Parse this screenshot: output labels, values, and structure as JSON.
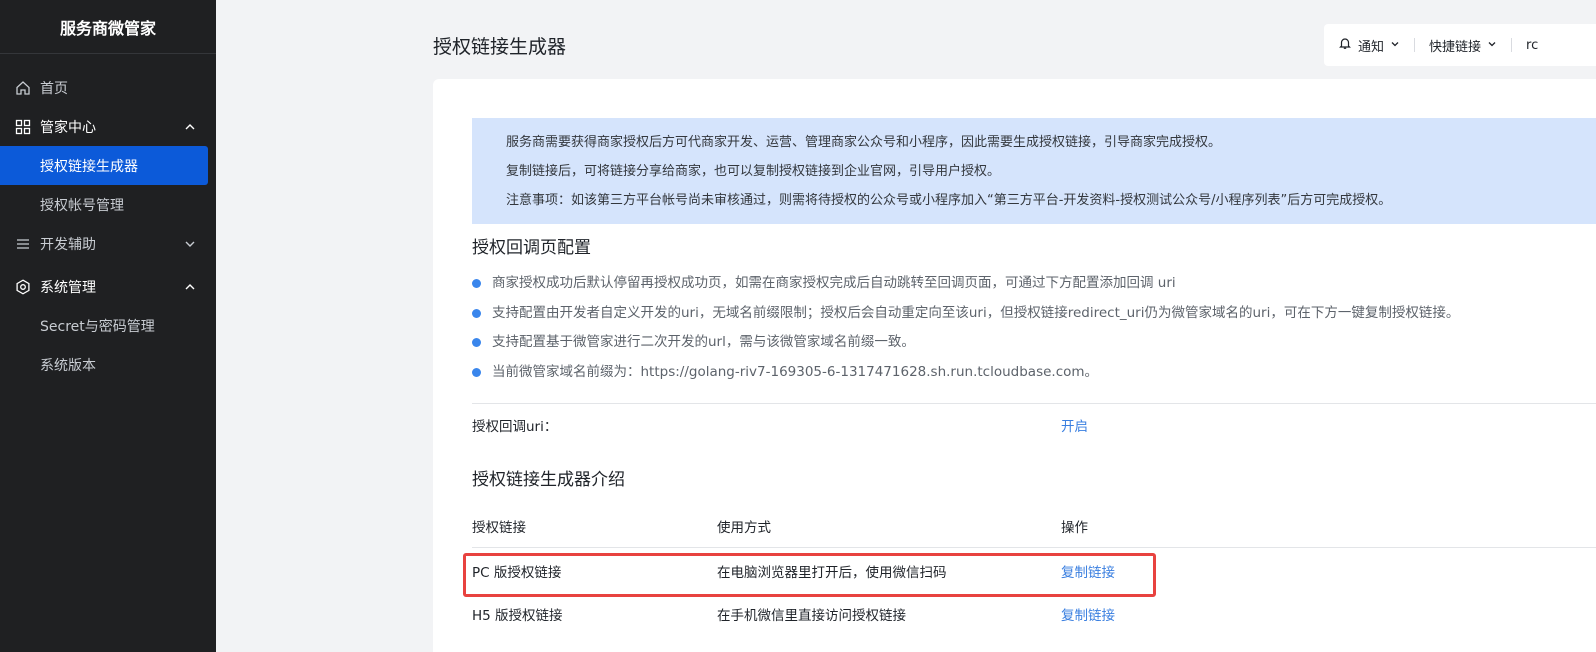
{
  "brand": "服务商微管家",
  "sidebar": {
    "home": "首页",
    "group_butler": "管家中心",
    "auth_link_generator": "授权链接生成器",
    "auth_account_mgmt": "授权帐号管理",
    "group_dev": "开发辅助",
    "group_system": "系统管理",
    "secret_mgmt": "Secret与密码管理",
    "system_version": "系统版本"
  },
  "header": {
    "title": "授权链接生成器",
    "notify": "通知",
    "quick_links": "快捷链接",
    "user_initial": "rc"
  },
  "notice": [
    "服务商需要获得商家授权后方可代商家开发、运营、管理商家公众号和小程序，因此需要生成授权链接，引导商家完成授权。",
    "复制链接后，可将链接分享给商家，也可以复制授权链接到企业官网，引导用户授权。",
    "注意事项：如该第三方平台帐号尚未审核通过，则需将待授权的公众号或小程序加入“第三方平台-开发资料-授权测试公众号/小程序列表”后方可完成授权。"
  ],
  "callback": {
    "title": "授权回调页配置",
    "bullets": [
      "商家授权成功后默认停留再授权成功页，如需在商家授权完成后自动跳转至回调页面，可通过下方配置添加回调 uri",
      "支持配置由开发者自定义开发的uri，无域名前缀限制；授权后会自动重定向至该uri，但授权链接redirect_uri仍为微管家域名的uri，可在下方一键复制授权链接。",
      "支持配置基于微管家进行二次开发的url，需与该微管家域名前缀一致。",
      "当前微管家域名前缀为：https://golang-riv7-169305-6-1317471628.sh.run.tcloudbase.com。"
    ],
    "uri_label": "授权回调uri：",
    "enable_link": "开启"
  },
  "intro": {
    "title": "授权链接生成器介绍",
    "columns": [
      "授权链接",
      "使用方式",
      "操作"
    ],
    "rows": [
      {
        "name": "PC 版授权链接",
        "usage": "在电脑浏览器里打开后，使用微信扫码",
        "action": "复制链接"
      },
      {
        "name": "H5 版授权链接",
        "usage": "在手机微信里直接访问授权链接",
        "action": "复制链接"
      }
    ]
  },
  "colors": {
    "sidebar_bg": "#1f2022",
    "active_item": "#0c5ad9",
    "notice_bg": "#d5e4fc",
    "link": "#3a7fe0",
    "highlight_border": "#e8423f"
  },
  "icons": [
    "home-icon",
    "grid-icon",
    "list-icon",
    "gear-icon",
    "bell-icon",
    "chevron-up-icon",
    "chevron-down-icon"
  ]
}
